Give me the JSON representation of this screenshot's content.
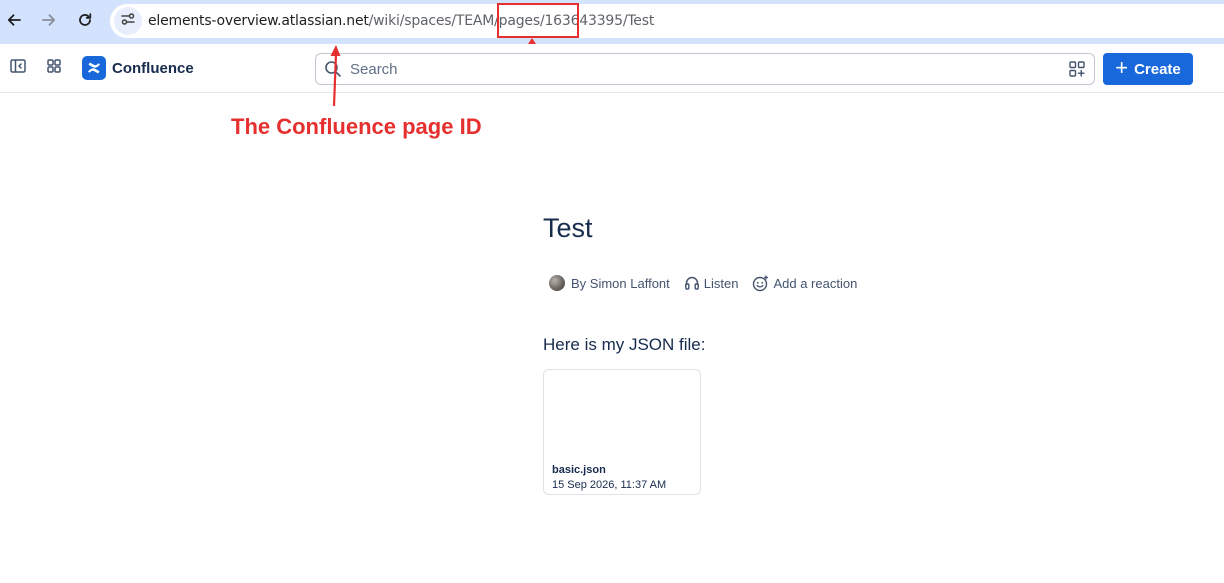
{
  "browser": {
    "url_host": "elements-overview.atlassian.net",
    "url_path": "/wiki/spaces/TEAM/pages/163643395/Test"
  },
  "topnav": {
    "app_name": "Confluence",
    "search_placeholder": "Search",
    "create_label": "Create"
  },
  "annotation": {
    "label": "The Confluence page ID"
  },
  "page": {
    "title": "Test",
    "author": "By Simon Laffont",
    "listen_label": "Listen",
    "reaction_label": "Add a reaction",
    "body_text": "Here is my JSON file:"
  },
  "attachment": {
    "name": "basic.json",
    "date": "15 Sep 2026, 11:37 AM"
  },
  "colors": {
    "brand": "#1868db",
    "annotation": "#e5302f",
    "browser_bar": "#d3e3fd"
  },
  "icons": [
    "back-arrow-icon",
    "forward-arrow-icon",
    "reload-icon",
    "site-info-icon",
    "sidebar-toggle-icon",
    "app-switcher-icon",
    "confluence-logo-icon",
    "search-icon",
    "apps-icon",
    "plus-icon",
    "avatar",
    "listen-icon",
    "add-reaction-icon"
  ]
}
